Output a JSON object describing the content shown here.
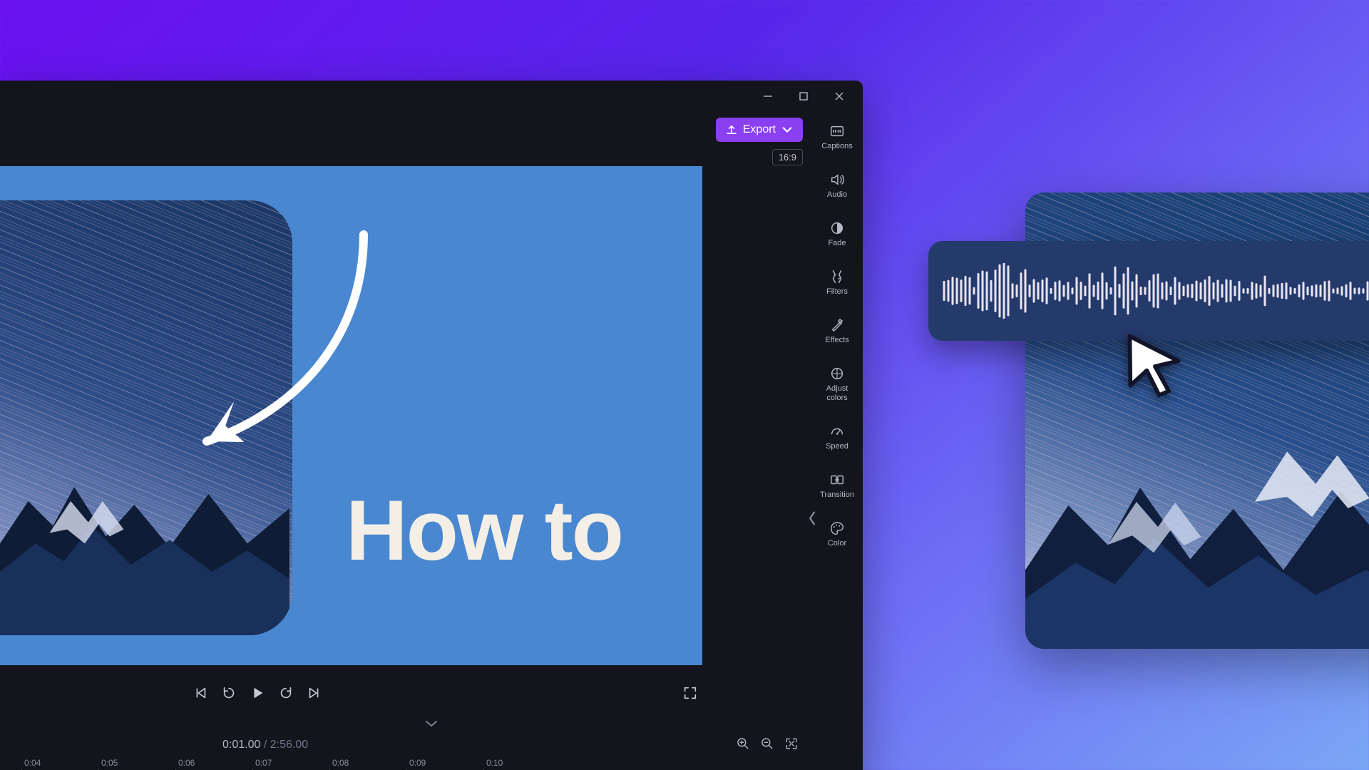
{
  "window": {
    "minimize": "Minimize",
    "maximize": "Maximize",
    "close": "Close"
  },
  "header": {
    "export_label": "Export",
    "aspect_ratio": "16:9"
  },
  "tools": {
    "captions": "Captions",
    "audio": "Audio",
    "fade": "Fade",
    "filters": "Filters",
    "effects": "Effects",
    "adjust": "Adjust\ncolors",
    "speed": "Speed",
    "transition": "Transition",
    "color": "Color"
  },
  "canvas": {
    "overlay_text": "How to"
  },
  "transport": {},
  "timeline": {
    "current": "0:01.00",
    "total": "2:56.00",
    "separator": "/",
    "ticks": [
      "0:04",
      "0:05",
      "0:06",
      "0:07",
      "0:08",
      "0:09",
      "0:10"
    ]
  }
}
